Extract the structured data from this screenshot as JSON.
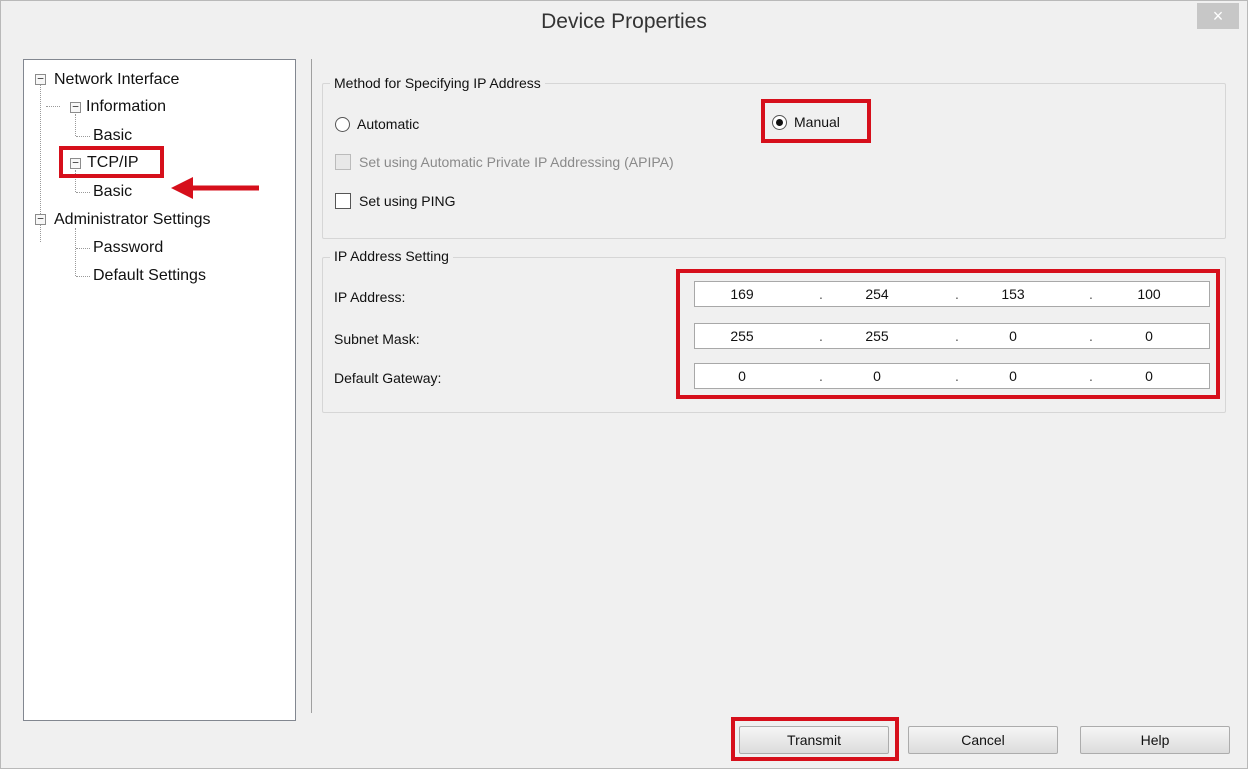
{
  "window": {
    "title": "Device Properties",
    "close_label": "×"
  },
  "tree": {
    "network_interface": "Network Interface",
    "information": "Information",
    "info_basic": "Basic",
    "tcpip": "TCP/IP",
    "tcpip_basic": "Basic",
    "administrator_settings": "Administrator Settings",
    "password": "Password",
    "default_settings": "Default Settings",
    "expander_glyph": "−"
  },
  "method_group": {
    "label": "Method for Specifying IP Address",
    "automatic": "Automatic",
    "manual": "Manual",
    "selected": "Manual",
    "apipa": "Set using Automatic Private IP Addressing (APIPA)",
    "ping": "Set using PING"
  },
  "ip_group": {
    "label": "IP Address Setting",
    "ip_address_label": "IP Address:",
    "subnet_mask_label": "Subnet Mask:",
    "default_gateway_label": "Default Gateway:",
    "ip_address": [
      "169",
      "254",
      "153",
      "100"
    ],
    "subnet_mask": [
      "255",
      "255",
      "0",
      "0"
    ],
    "default_gateway": [
      "0",
      "0",
      "0",
      "0"
    ],
    "separator": "."
  },
  "buttons": {
    "transmit": "Transmit",
    "cancel": "Cancel",
    "help": "Help"
  },
  "colors": {
    "highlight": "#d60f1b",
    "window_bg": "#f0f0f0"
  }
}
